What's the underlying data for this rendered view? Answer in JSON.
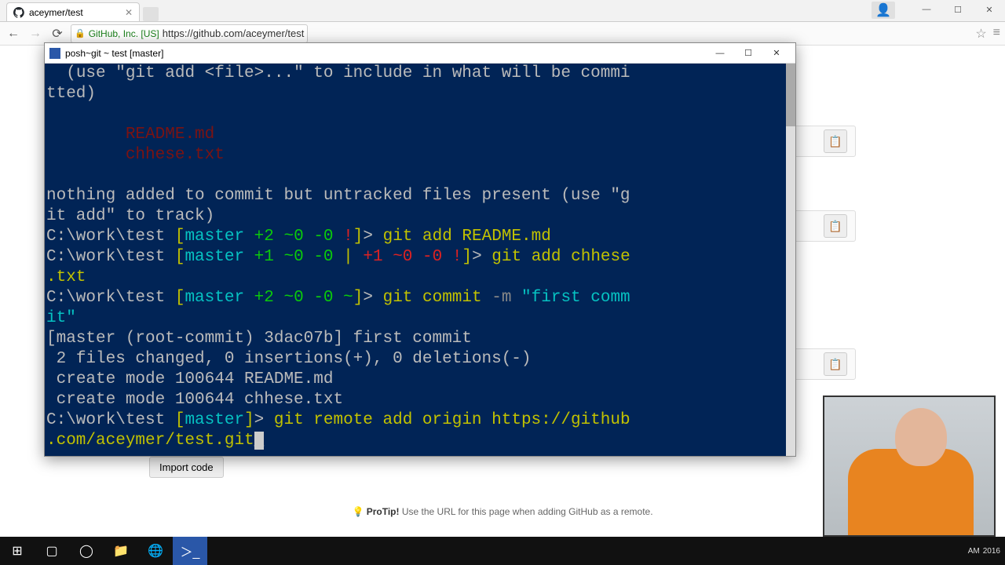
{
  "browser": {
    "tab_title": "aceymer/test",
    "org_name": "GitHub, Inc. [US]",
    "url": "https://github.com/aceymer/test"
  },
  "github": {
    "import_button": "Import code",
    "protip_label": "ProTip!",
    "protip_text": " Use the URL for this page when adding GitHub as a remote."
  },
  "terminal": {
    "title": "posh~git ~ test [master]",
    "wrap_hint_open": "  (use \"git add <file>...\" to include in what will be commi",
    "wrap_hint_close": "tted)",
    "untracked1": "        README.md",
    "untracked2": "        chhese.txt",
    "nothing_added1": "nothing added to commit but untracked files present (use \"g",
    "nothing_added2": "it add\" to track)",
    "path": "C:\\work\\test ",
    "br_open": "[",
    "branch": "master",
    "sp": " ",
    "p2": "+2",
    "p1": "+1",
    "t0": "~0",
    "m0": "-0",
    "ex": "!",
    "pipe": "| ",
    "tilde": "~",
    "br_close": "]",
    "gt": "> ",
    "cmd_add1": "git add README.md",
    "cmd_add2_a": "git add chhese",
    "cmd_add2_b": ".txt",
    "cmd_commit": "git commit ",
    "cmd_commit_flag": "-m ",
    "cmd_commit_msg1": "\"first comm",
    "cmd_commit_msg2": "it\"",
    "out1": "[master (root-commit) 3dac07b] first commit",
    "out2": " 2 files changed, 0 insertions(+), 0 deletions(-)",
    "out3": " create mode 100644 README.md",
    "out4": " create mode 100644 chhese.txt",
    "cmd_remote1": "git remote add origin https://github",
    "cmd_remote2": ".com/aceymer/test.git"
  },
  "taskbar": {
    "time": "AM",
    "date": "2016"
  }
}
